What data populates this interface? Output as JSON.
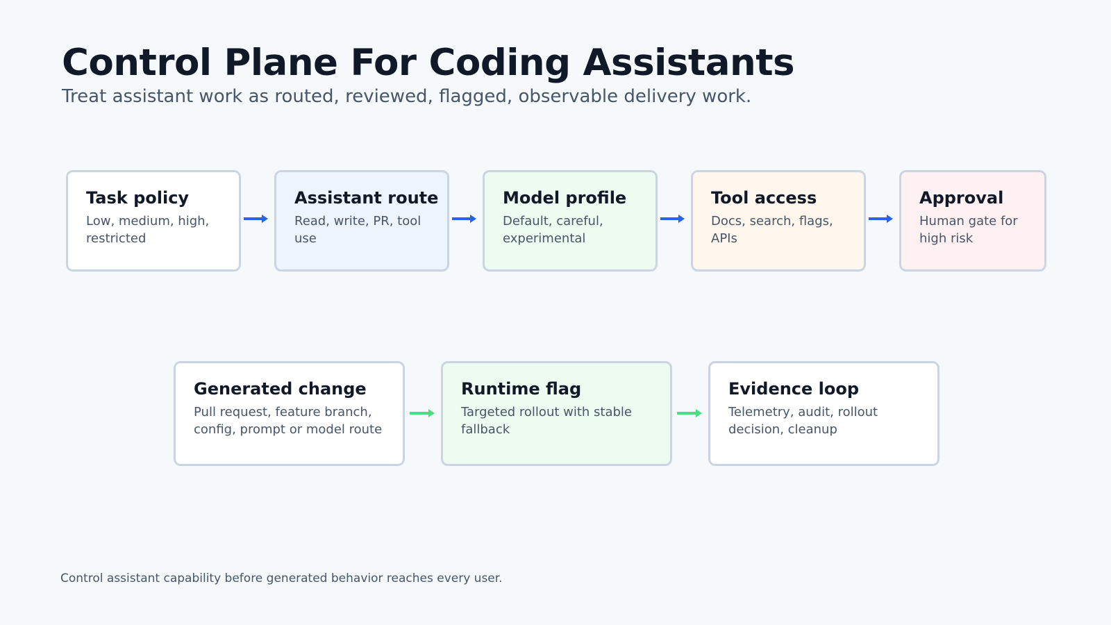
{
  "header": {
    "title": "Control Plane For Coding Assistants",
    "subtitle": "Treat assistant work as routed, reviewed, flagged, observable delivery work."
  },
  "row1": [
    {
      "title": "Task policy",
      "body": "Low, medium, high, restricted",
      "fill": "#ffffff"
    },
    {
      "title": "Assistant route",
      "body": "Read, write, PR, tool use",
      "fill": "#eef4fe"
    },
    {
      "title": "Model profile",
      "body": "Default, careful, experimental",
      "fill": "#edfbf1"
    },
    {
      "title": "Tool access",
      "body": "Docs, search, flags, APIs",
      "fill": "#fff7ed"
    },
    {
      "title": "Approval",
      "body": "Human gate for high risk",
      "fill": "#fff1f2"
    }
  ],
  "row2": [
    {
      "title": "Generated change",
      "body": "Pull request, feature branch, config, prompt or model route",
      "fill": "#ffffff"
    },
    {
      "title": "Runtime flag",
      "body": "Targeted rollout with stable fallback",
      "fill": "#edfbf1"
    },
    {
      "title": "Evidence loop",
      "body": "Telemetry, audit, rollout decision, cleanup",
      "fill": "#ffffff"
    }
  ],
  "colors": {
    "row1_arrow": "#2563eb",
    "row2_arrow": "#4ade80",
    "card_border": "#cbd5e1",
    "background": "#f6f9fc"
  },
  "footer": {
    "note": "Control assistant capability before generated behavior reaches every user."
  }
}
